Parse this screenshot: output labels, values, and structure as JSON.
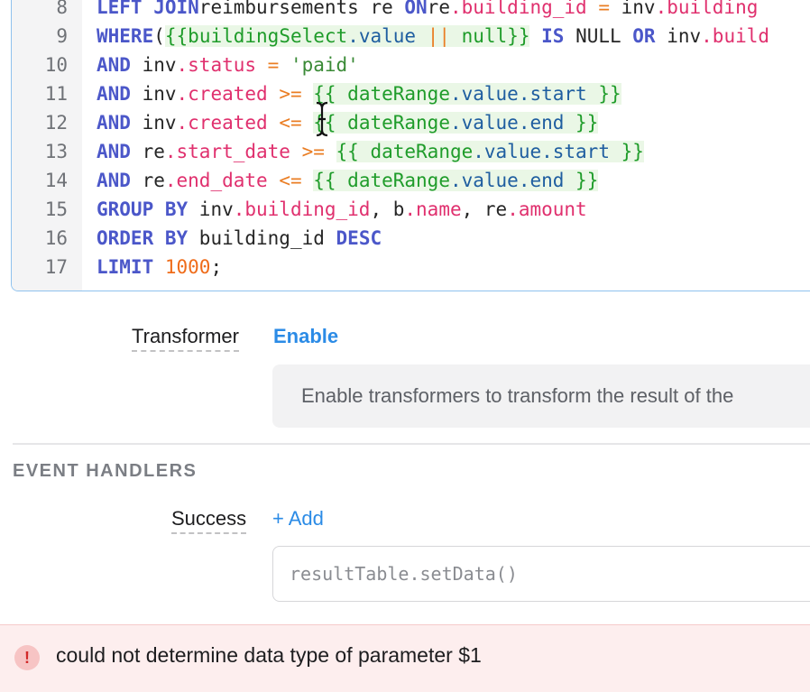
{
  "editor": {
    "lines": [
      {
        "n": "8",
        "tokens": [
          [
            "kw",
            "LEFT JOIN"
          ],
          [
            "",
            "reimbursements re "
          ],
          [
            "kw",
            "ON"
          ],
          [
            "",
            "re"
          ],
          [
            "prop",
            ".building_id"
          ],
          [
            "op",
            " = "
          ],
          [
            "",
            "inv"
          ],
          [
            "prop",
            ".building"
          ]
        ]
      },
      {
        "n": "9",
        "tokens": [
          [
            "kw",
            "WHERE"
          ],
          [
            "",
            "("
          ],
          [
            "tmpl",
            "{{"
          ],
          [
            "tmpl",
            "buildingSelect"
          ],
          [
            "tmpl-id",
            ".value"
          ],
          [
            "tmpl-op",
            " || "
          ],
          [
            "tmpl",
            "null}}"
          ],
          [
            "",
            ""
          ],
          [
            "kw",
            " IS"
          ],
          [
            "",
            " NULL "
          ],
          [
            "kw",
            "OR"
          ],
          [
            "",
            " inv"
          ],
          [
            "prop",
            ".build"
          ]
        ]
      },
      {
        "n": "10",
        "tokens": [
          [
            "kw",
            "AND"
          ],
          [
            "",
            " inv"
          ],
          [
            "prop",
            ".status"
          ],
          [
            "op",
            " = "
          ],
          [
            "str",
            "'paid'"
          ]
        ]
      },
      {
        "n": "11",
        "tokens": [
          [
            "kw",
            "AND"
          ],
          [
            "",
            " inv"
          ],
          [
            "prop",
            ".created"
          ],
          [
            "op",
            " >= "
          ],
          [
            "tmpl",
            "{{ dateRange"
          ],
          [
            "tmpl-id",
            ".value.start"
          ],
          [
            "tmpl",
            " }}"
          ]
        ]
      },
      {
        "n": "12",
        "tokens": [
          [
            "kw",
            "AND"
          ],
          [
            "",
            " inv"
          ],
          [
            "prop",
            ".created"
          ],
          [
            "op",
            " <= "
          ],
          [
            "tmpl",
            "{{ dateRange"
          ],
          [
            "tmpl-id",
            ".value.end"
          ],
          [
            "tmpl",
            " }}"
          ]
        ]
      },
      {
        "n": "13",
        "tokens": [
          [
            "kw",
            "AND"
          ],
          [
            "",
            " re"
          ],
          [
            "prop",
            ".start_date"
          ],
          [
            "op",
            " >= "
          ],
          [
            "tmpl",
            "{{ dateRange"
          ],
          [
            "tmpl-id",
            ".value.start"
          ],
          [
            "tmpl",
            " }}"
          ]
        ]
      },
      {
        "n": "14",
        "tokens": [
          [
            "kw",
            "AND"
          ],
          [
            "",
            " re"
          ],
          [
            "prop",
            ".end_date"
          ],
          [
            "op",
            " <= "
          ],
          [
            "tmpl",
            "{{ dateRange"
          ],
          [
            "tmpl-id",
            ".value.end"
          ],
          [
            "tmpl",
            " }}"
          ]
        ]
      },
      {
        "n": "15",
        "tokens": [
          [
            "kw",
            "GROUP BY"
          ],
          [
            "",
            " inv"
          ],
          [
            "prop",
            ".building_id"
          ],
          [
            "",
            ", b"
          ],
          [
            "prop",
            ".name"
          ],
          [
            "",
            ", re"
          ],
          [
            "prop",
            ".amount"
          ]
        ]
      },
      {
        "n": "16",
        "tokens": [
          [
            "kw",
            "ORDER BY"
          ],
          [
            "",
            " building_id "
          ],
          [
            "kw",
            "DESC"
          ]
        ]
      },
      {
        "n": "17",
        "tokens": [
          [
            "kw",
            "LIMIT"
          ],
          [
            "num",
            " 1000"
          ],
          [
            "",
            ";"
          ]
        ]
      }
    ]
  },
  "transformer": {
    "label": "Transformer",
    "enable_label": "Enable",
    "info_text": "Enable transformers to transform the result of the"
  },
  "event_handlers": {
    "section_title": "EVENT HANDLERS",
    "success_label": "Success",
    "add_label": "+ Add",
    "input_placeholder": "resultTable.setData()"
  },
  "error": {
    "icon": "!",
    "message": "could not determine data type of parameter $1"
  }
}
